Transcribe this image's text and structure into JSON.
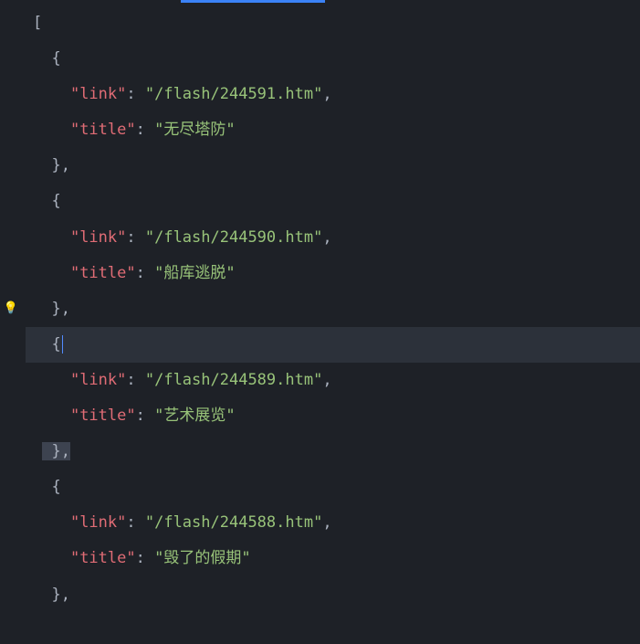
{
  "editor": {
    "lines": [
      {
        "text": "[",
        "indent": 0
      },
      {
        "text": "{",
        "indent": 1
      },
      {
        "key": "link",
        "value": "/flash/244591.htm",
        "indent": 2,
        "comma": true
      },
      {
        "key": "title",
        "value": "无尽塔防",
        "indent": 2,
        "comma": false
      },
      {
        "text": "},",
        "indent": 1
      },
      {
        "text": "{",
        "indent": 1
      },
      {
        "key": "link",
        "value": "/flash/244590.htm",
        "indent": 2,
        "comma": true
      },
      {
        "key": "title",
        "value": "船库逃脱",
        "indent": 2,
        "comma": false
      },
      {
        "text": "},",
        "indent": 1,
        "bulb": true
      },
      {
        "text": "{",
        "indent": 1,
        "highlighted": true,
        "cursor": true
      },
      {
        "key": "link",
        "value": "/flash/244589.htm",
        "indent": 2,
        "comma": true
      },
      {
        "key": "title",
        "value": "艺术展览",
        "indent": 2,
        "comma": false
      },
      {
        "text": "},",
        "indent": 1,
        "selected": true
      },
      {
        "text": "{",
        "indent": 1
      },
      {
        "key": "link",
        "value": "/flash/244588.htm",
        "indent": 2,
        "comma": true
      },
      {
        "key": "title",
        "value": "毁了的假期",
        "indent": 2,
        "comma": false
      },
      {
        "text": "},",
        "indent": 1
      }
    ]
  }
}
